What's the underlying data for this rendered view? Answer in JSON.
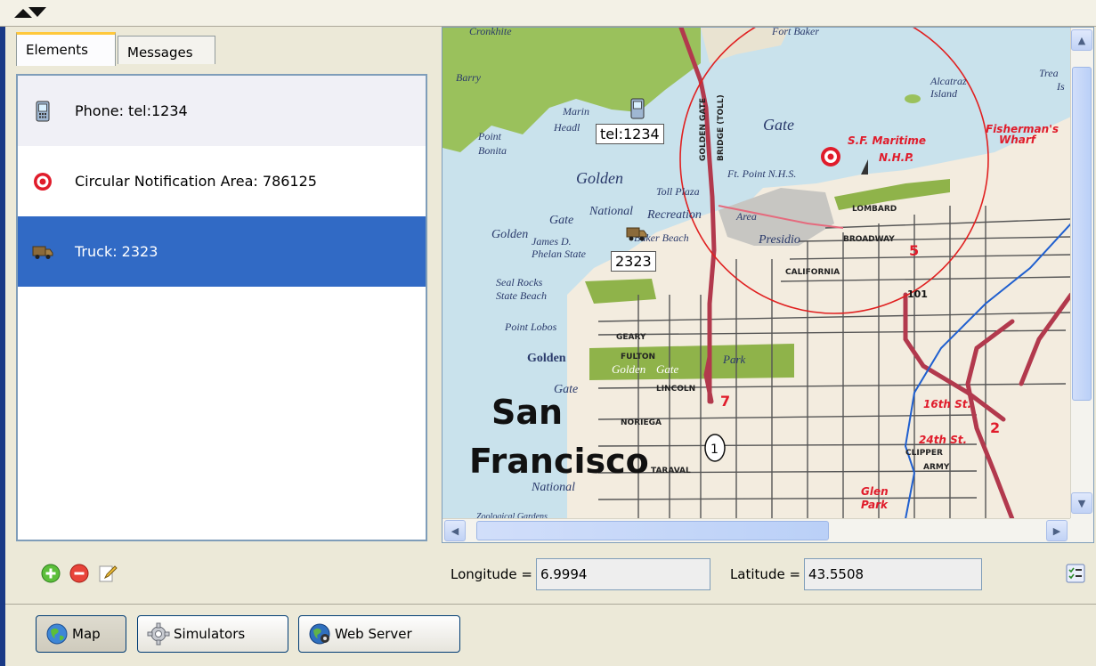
{
  "tabs": [
    {
      "label": "Elements",
      "active": true
    },
    {
      "label": "Messages",
      "active": false
    }
  ],
  "elements_list": [
    {
      "label": "Phone: tel:1234",
      "icon": "phone-icon"
    },
    {
      "label": "Circular Notification Area: 786125",
      "icon": "target-icon"
    },
    {
      "label": "Truck: 2323",
      "icon": "truck-icon",
      "selected": true
    }
  ],
  "list_toolbar": {
    "add_icon": "add-icon",
    "remove_icon": "remove-icon",
    "edit_icon": "pencil-icon"
  },
  "map": {
    "markers": {
      "phone_tag": "tel:1234",
      "truck_tag": "2323"
    },
    "labels": {
      "san": "San",
      "francisco": "Francisco",
      "golden_gate_bridge": "GOLDEN GATE",
      "bridge_toll": "BRIDGE (TOLL)",
      "maritime": "S.F. Maritime",
      "nhp": "N.H.P.",
      "fishermans": "Fisherman's",
      "wharf": "Wharf",
      "alcatraz": "Alcatraz",
      "island": "Island",
      "golden": "Golden",
      "gate": "Gate",
      "marin": "Marin",
      "headlands": "Headl",
      "point_bonita": "Point",
      "bonita": "Bonita",
      "barry": "Barry",
      "cronkhite": "Cronkhite",
      "presidio": "Presidio",
      "national": "National",
      "recreation": "Recreation",
      "area": "Area",
      "lincoln": "LINCOLN",
      "geary": "GEARY",
      "fulton": "FULTON",
      "golden_gate_park_a": "Golden",
      "golden_gate_park_b": "Gate",
      "park": "Park",
      "noriega": "NORIEGA",
      "taraval": "TARAVAL",
      "broadway": "BROADWAY",
      "california": "CALIFORNIA",
      "lombard": "LOMBARD",
      "st_16": "16th St.",
      "st_24": "24th St.",
      "clipper": "CLIPPER",
      "army": "ARMY",
      "glen": "Glen",
      "glen_park": "Park",
      "seal_rocks": "Seal Rocks",
      "state_beach": "State Beach",
      "point_lobos": "Point Lobos",
      "golden_left": "Golden",
      "gate_left": "Gate",
      "national_bottom": "National",
      "zoological": "Zoological Gardens",
      "route_1": "1",
      "route_101": "101",
      "route_5": "5",
      "route_7": "7",
      "route_2": "2",
      "ft_point": "Ft. Point N.H.S.",
      "toll_plaza": "Toll Plaza",
      "james_d": "James D.",
      "phelan_state": "Phelan State",
      "baker_beach": "Baker Beach",
      "fort_baker": "Fort Baker",
      "treasure": "Trea",
      "is": "Is"
    },
    "notification_circle_color": "#e02020"
  },
  "coords": {
    "longitude_label": "Longitude =",
    "longitude_value": "6.9994",
    "latitude_label": "Latitude =",
    "latitude_value": "43.5508"
  },
  "bottom_buttons": [
    {
      "label": "Map",
      "icon": "globe-icon",
      "active": true
    },
    {
      "label": "Simulators",
      "icon": "gear-icon",
      "active": false
    },
    {
      "label": "Web Server",
      "icon": "web-globe-icon",
      "active": false
    }
  ],
  "colors": {
    "selection": "#316ac5",
    "frame": "#1a3a86",
    "tab_highlight": "#ffc83c"
  }
}
